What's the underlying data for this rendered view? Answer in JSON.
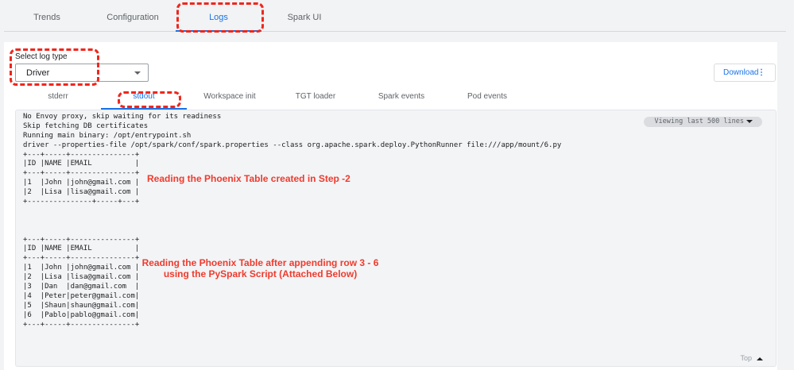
{
  "top_tabs": [
    {
      "label": "Trends"
    },
    {
      "label": "Configuration"
    },
    {
      "label": "Logs"
    },
    {
      "label": "Spark UI"
    }
  ],
  "select": {
    "label": "Select log type",
    "value": "Driver"
  },
  "download_label": "Download",
  "download_more": "⋮",
  "sub_tabs": [
    {
      "label": "stderr"
    },
    {
      "label": "stdout"
    },
    {
      "label": "Workspace init"
    },
    {
      "label": "TGT loader"
    },
    {
      "label": "Spark events"
    },
    {
      "label": "Pod events"
    }
  ],
  "viewing": "Viewing last 500 lines",
  "top_label": "Top",
  "log_lines": [
    "No Envoy proxy, skip waiting for its readiness",
    "Skip fetching DB certificates",
    "Running main binary: /opt/entrypoint.sh",
    "driver --properties-file /opt/spark/conf/spark.properties --class org.apache.spark.deploy.PythonRunner file:///app/mount/6.py",
    "+---+-----+---------------+",
    "|ID |NAME |EMAIL          |",
    "+---+-----+---------------+",
    "|1  |John |john@gmail.com |",
    "|2  |Lisa |lisa@gmail.com |",
    "+---------------+-----+---+",
    "",
    "",
    "",
    "+---+-----+---------------+",
    "|ID |NAME |EMAIL          |",
    "+---+-----+---------------+",
    "|1  |John |john@gmail.com |",
    "|2  |Lisa |lisa@gmail.com |",
    "|3  |Dan  |dan@gmail.com  |",
    "|4  |Peter|peter@gmail.com|",
    "|5  |Shaun|shaun@gmail.com|",
    "|6  |Pablo|pablo@gmail.com|",
    "+---+-----+---------------+"
  ],
  "annotations": {
    "first": "Reading the Phoenix Table created in Step -2",
    "second_line1": "Reading the Phoenix Table after appending row 3 - 6",
    "second_line2": "using the PySpark Script (Attached Below)"
  }
}
